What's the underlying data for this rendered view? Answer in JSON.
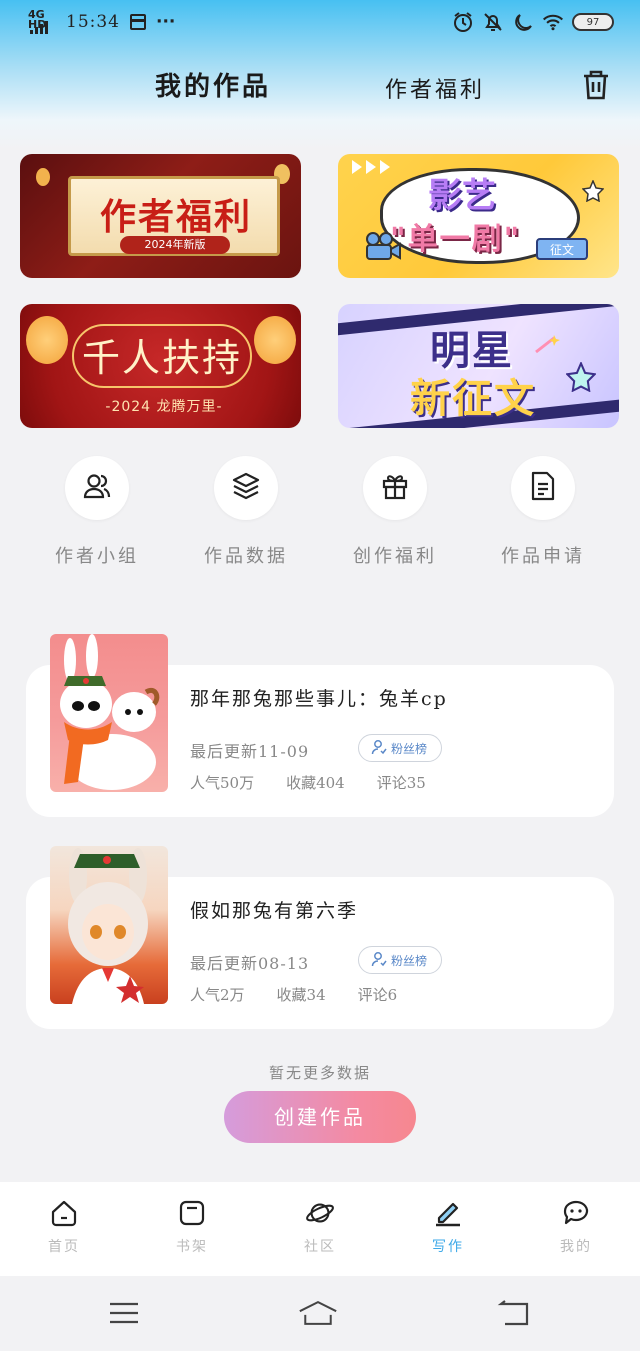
{
  "status_bar": {
    "network": "4G HD",
    "time": "15:34",
    "more": "···",
    "battery": "97"
  },
  "header": {
    "tab_my_works": "我的作品",
    "tab_author_benefits": "作者福利"
  },
  "banners": [
    {
      "title": "作者福利",
      "subtitle": "2024年新版"
    },
    {
      "title_line1": "影艺",
      "title_line2": "\"单一剧\"",
      "tag": "征文"
    },
    {
      "title": "千人扶持",
      "subtitle": "-2024 龙腾万里-"
    },
    {
      "title_line1": "明星",
      "title_line2": "新征文"
    }
  ],
  "quick_actions": [
    {
      "label": "作者小组",
      "icon": "users-icon"
    },
    {
      "label": "作品数据",
      "icon": "layers-icon"
    },
    {
      "label": "创作福利",
      "icon": "gift-icon"
    },
    {
      "label": "作品申请",
      "icon": "document-icon"
    }
  ],
  "works": [
    {
      "title": "那年那兔那些事儿：兔羊cp",
      "last_update": "最后更新11-09",
      "fan_button": "粉丝榜",
      "popularity": "人气50万",
      "favorites": "收藏404",
      "comments": "评论35"
    },
    {
      "title": "假如那兔有第六季",
      "last_update": "最后更新08-13",
      "fan_button": "粉丝榜",
      "popularity": "人气2万",
      "favorites": "收藏34",
      "comments": "评论6"
    }
  ],
  "no_more_text": "暂无更多数据",
  "create_button": "创建作品",
  "tab_bar": [
    {
      "label": "首页",
      "icon": "home-icon",
      "active": false
    },
    {
      "label": "书架",
      "icon": "bookshelf-icon",
      "active": false
    },
    {
      "label": "社区",
      "icon": "planet-icon",
      "active": false
    },
    {
      "label": "写作",
      "icon": "pen-icon",
      "active": true
    },
    {
      "label": "我的",
      "icon": "chat-bubble-icon",
      "active": false
    }
  ],
  "colors": {
    "accent": "#3ea9e8",
    "create_gradient_start": "#d59cdc",
    "create_gradient_end": "#f6878f",
    "header_gradient_top": "#47c0f2"
  }
}
